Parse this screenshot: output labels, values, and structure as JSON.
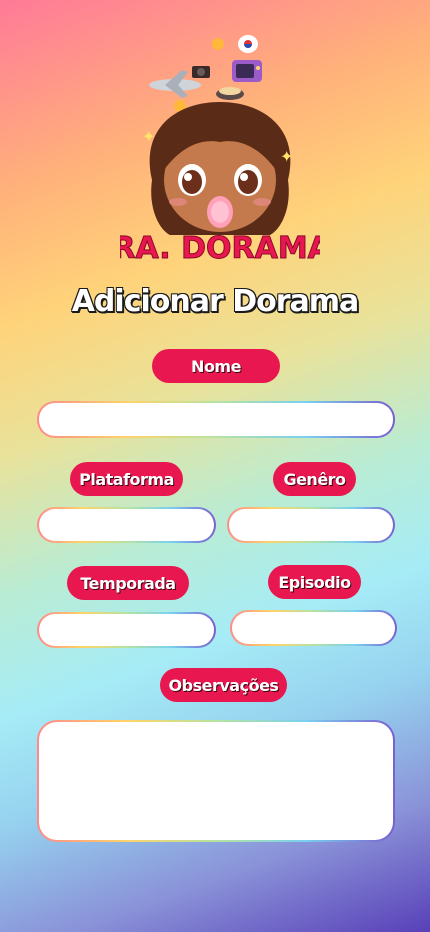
{
  "logo": {
    "text": "DRA. DORAMAS",
    "description_icon": "cartoon-girl-logo-icon"
  },
  "page": {
    "title": "Adicionar Dorama"
  },
  "form": {
    "nome": {
      "label": "Nome",
      "value": "",
      "placeholder": ""
    },
    "plataforma": {
      "label": "Plataforma",
      "value": "",
      "placeholder": ""
    },
    "genero": {
      "label": "Genêro",
      "value": "",
      "placeholder": ""
    },
    "temporada": {
      "label": "Temporada",
      "value": "",
      "placeholder": ""
    },
    "episodio": {
      "label": "Episodio",
      "value": "",
      "placeholder": ""
    },
    "observacoes": {
      "label": "Observações",
      "value": "",
      "placeholder": ""
    }
  },
  "colors": {
    "accent": "#e8174f",
    "title_text": "#ffffff"
  }
}
